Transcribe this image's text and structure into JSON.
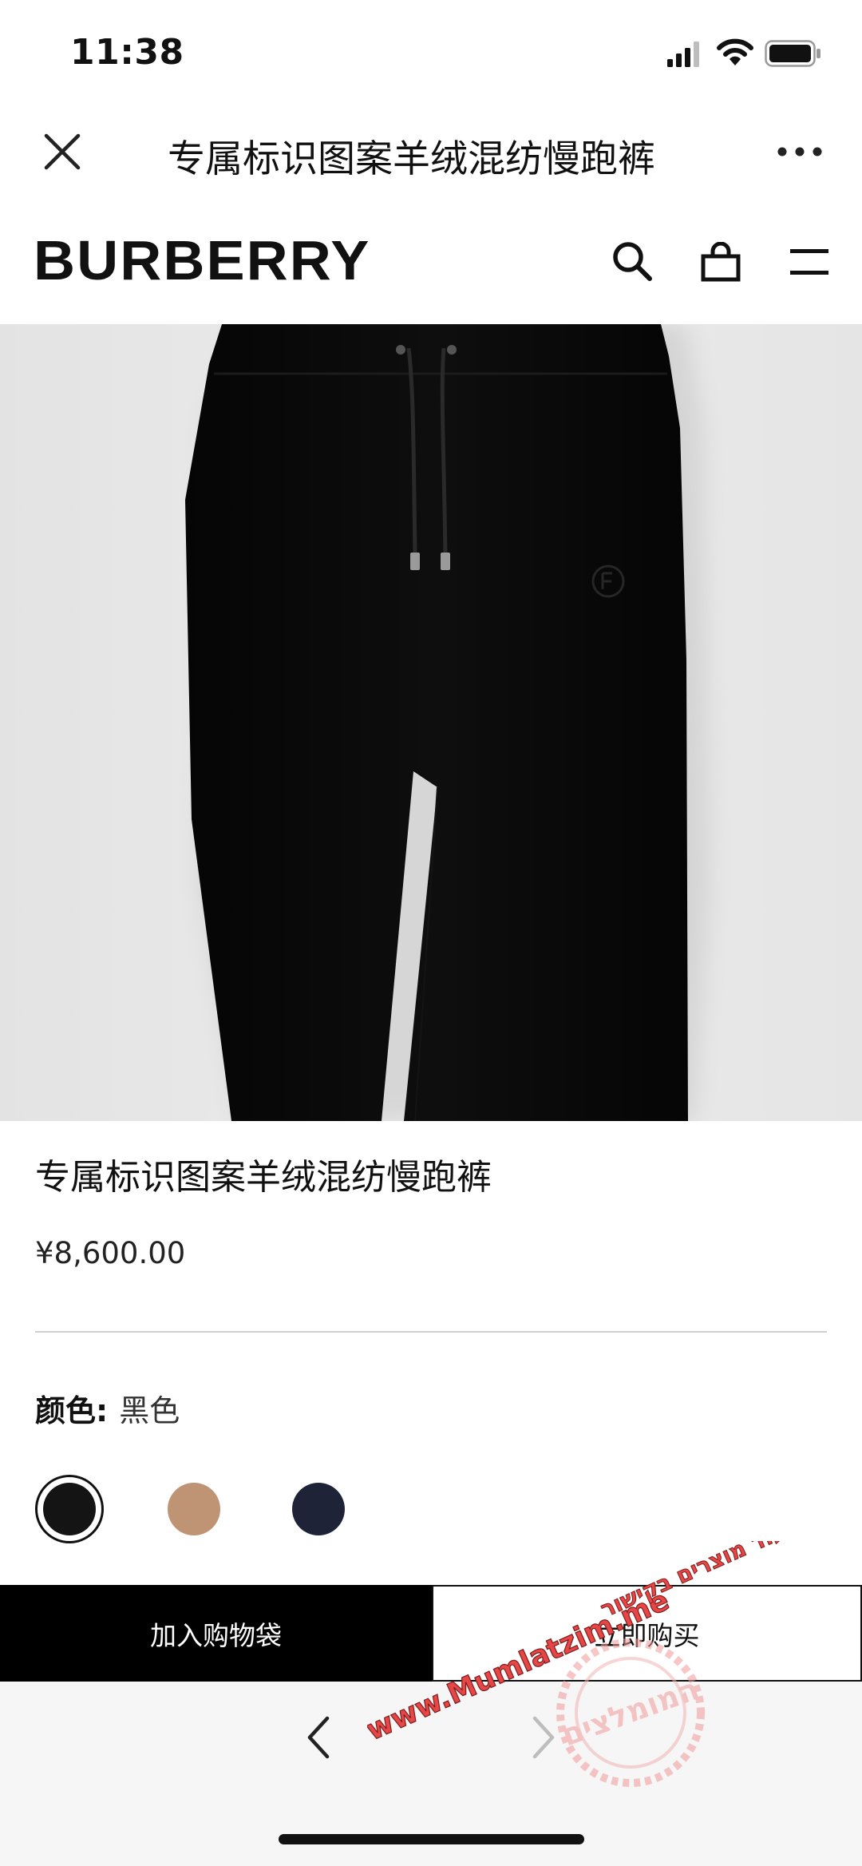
{
  "status_bar": {
    "time": "11:38"
  },
  "nav_bar": {
    "title": "专属标识图案羊绒混纺慢跑裤"
  },
  "brand": {
    "logo_text": "BURBERRY"
  },
  "product": {
    "name": "专属标识图案羊绒混纺慢跑裤",
    "price": "¥8,600.00",
    "color_label": "颜色:",
    "selected_color": "黑色",
    "swatches": [
      {
        "color": "#141414",
        "selected": true
      },
      {
        "color": "#bf9474",
        "selected": false
      },
      {
        "color": "#1f2337",
        "selected": false
      }
    ]
  },
  "actions": {
    "add_to_bag": "加入购物袋",
    "buy_now": "立即购买"
  },
  "watermark": {
    "url_text": "www.Mumlatzim.me",
    "hebrew_text": "לעוד מוצרים בקישור",
    "seal_text": "המומלצים"
  }
}
